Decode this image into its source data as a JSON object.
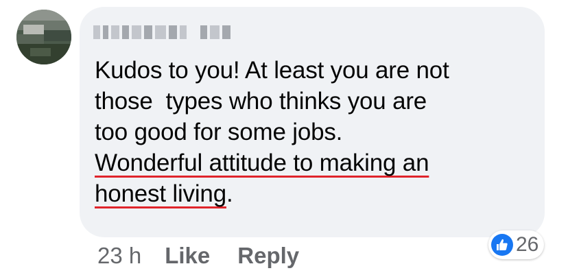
{
  "comment": {
    "author_name": "",
    "text_lines": [
      "Kudos to you! At least you are not",
      "those  types who thinks you are",
      "too good for some jobs."
    ],
    "underlined_lines": [
      "Wonderful attitude to making an",
      "honest living"
    ],
    "trailing_punctuation": ".",
    "underline_color": "#e0242b"
  },
  "actions": {
    "timestamp": "23 h",
    "like_label": "Like",
    "reply_label": "Reply"
  },
  "reactions": {
    "icon": "thumbs-up-icon",
    "count": "26",
    "color": "#1877f2"
  },
  "colors": {
    "bubble": "#f0f2f5",
    "text": "#050505",
    "meta": "#65676b"
  }
}
